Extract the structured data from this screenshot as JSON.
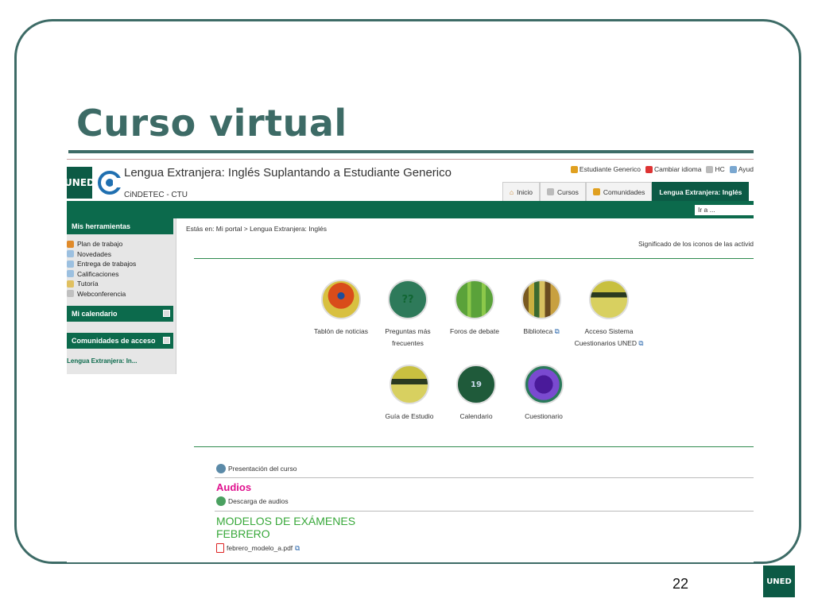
{
  "slide": {
    "title": "Curso virtual",
    "page_number": "22",
    "footer_logo": "UNED"
  },
  "header": {
    "logo_text": "UNED",
    "site_title": "Lengua Extranjera: Inglés Suplantando a Estudiante Generico",
    "subtitle": "CiNDETEC - CTU",
    "user_links": [
      "Estudiante Generico",
      "Cambiar idioma",
      "HC",
      "Ayud"
    ],
    "tabs": [
      {
        "label": "Inicio",
        "icon": "home-icon"
      },
      {
        "label": "Cursos",
        "icon": "book-icon"
      },
      {
        "label": "Comunidades",
        "icon": "people-icon"
      },
      {
        "label": "Lengua Extranjera: Inglés",
        "active": true
      }
    ],
    "goto_placeholder": "Ir a ..."
  },
  "sidebar": {
    "tools_heading": "Mis herramientas",
    "tools": [
      "Plan de trabajo",
      "Novedades",
      "Entrega de trabajos",
      "Calificaciones",
      "Tutoría",
      "Webconferencia"
    ],
    "calendar_heading": "Mi calendario",
    "communities_heading": "Comunidades de acceso",
    "community_item": "Lengua Extranjera: In..."
  },
  "main": {
    "breadcrumb": "Estás en: Mi portal > Lengua Extranjera: Inglés",
    "icon_meaning_link": "Significado de los iconos de las activid",
    "tools_row1": [
      {
        "label": "Tablón de noticias"
      },
      {
        "label": "Preguntas más frecuentes"
      },
      {
        "label": "Foros de debate"
      },
      {
        "label": "Biblioteca"
      },
      {
        "label": "Acceso Sistema Cuestionarios UNED"
      }
    ],
    "tools_row2": [
      {
        "label": "Guía de Estudio"
      },
      {
        "label": "Calendario"
      },
      {
        "label": "Cuestionario"
      }
    ],
    "resources": {
      "presentation": "Presentación del curso",
      "audios_heading": "Audios",
      "audio_download": "Descarga de audios",
      "exams_heading_1": "MODELOS DE EXÁMENES",
      "exams_heading_2": "FEBRERO",
      "exam_file": "febrero_modelo_a.pdf"
    }
  },
  "colors": {
    "accent": "#0c6a4c",
    "title": "#3d6b66",
    "audios": "#e0118e",
    "exams": "#38a83a"
  }
}
